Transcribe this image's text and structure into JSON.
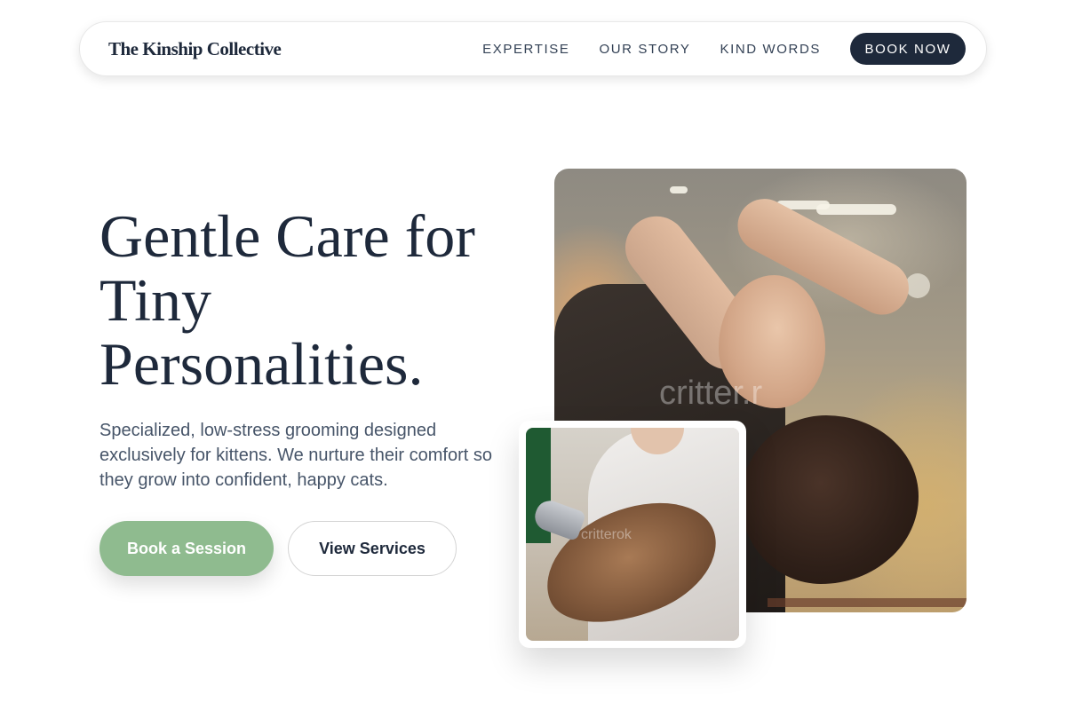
{
  "nav": {
    "brand": "The Kinship Collective",
    "links": [
      "EXPERTISE",
      "OUR STORY",
      "KIND WORDS"
    ],
    "cta_label": "BOOK NOW"
  },
  "hero": {
    "title_lines": [
      "Gentle Care for",
      "Tiny",
      "Personalities."
    ],
    "subtitle": "Specialized, low-stress grooming designed exclusively for kittens. We nurture their comfort so they grow into confident, happy cats.",
    "primary_button": "Book a Session",
    "secondary_button": "View Services"
  },
  "images": {
    "main_photo_watermark": "critter.r",
    "small_photo_watermark": "critterok"
  },
  "colors": {
    "brand_dark": "#1e293b",
    "accent_green": "#8fbb8f",
    "body_text": "#475569"
  }
}
